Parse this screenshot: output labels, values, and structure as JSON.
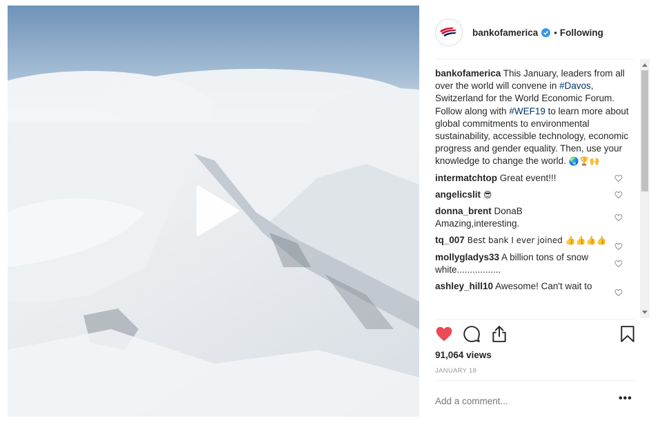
{
  "post": {
    "username": "bankofamerica",
    "follow_status": "Following",
    "separator": "•",
    "caption": {
      "username": "bankofamerica",
      "text_1": " This January, leaders from all over the world will convene in ",
      "tag_1": "#Davos",
      "text_2": ", Switzerland for the World Economic Forum. Follow along with ",
      "tag_2": "#WEF19",
      "text_3": " to learn more about global commitments to environmental sustainability, accessible technology, economic progress and gender equality. Then, use your knowledge to change the world. ",
      "emojis": "🌏🏆🙌"
    },
    "comments": [
      {
        "username": "intermatchtop",
        "text": " Great event!!!"
      },
      {
        "username": "angelicslit",
        "text": " 😎"
      },
      {
        "username": "donna_brent",
        "text": " DonaB Amazing,interesting."
      },
      {
        "username": "tq_007",
        "text": " Best bank I ever joined 👍👍👍👍"
      },
      {
        "username": "mollygladys33",
        "text": " A billion tons of snow white................."
      },
      {
        "username": "ashley_hill10",
        "text": " Awesome! Can't wait to"
      }
    ],
    "views": "91,064 views",
    "date": "JANUARY 18",
    "add_comment_placeholder": "Add a comment...",
    "more_label": "•••",
    "liked": true
  },
  "colors": {
    "like_red": "#ed4956",
    "verified_blue": "#3897f0",
    "hashtag": "#003569"
  },
  "icons": {
    "play": "play-icon",
    "like": "heart-icon",
    "comment": "speech-bubble-icon",
    "share": "share-icon",
    "save": "bookmark-icon",
    "avatar": "bank-flag-logo"
  }
}
